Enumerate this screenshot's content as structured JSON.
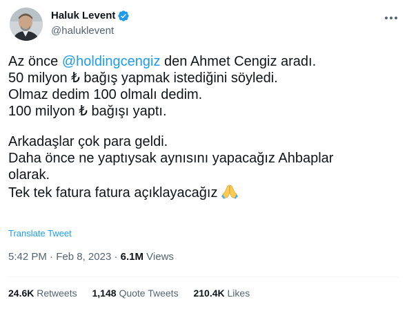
{
  "author": {
    "display_name": "Haluk Levent",
    "handle": "@haluklevent",
    "verified": true
  },
  "tweet": {
    "lines": [
      {
        "before": "Az önce ",
        "mention": "@holdingcengiz",
        "after": " den Ahmet Cengiz aradı."
      },
      {
        "text": "50 milyon ₺ bağış yapmak istediğini söyledi."
      },
      {
        "text": "Olmaz dedim 100 olmalı dedim."
      },
      {
        "text": "100 milyon ₺ bağışı yaptı."
      },
      {
        "text": "Arkadaşlar çok para geldi."
      },
      {
        "text": "Daha önce ne yaptıysak aynısını yapacağız Ahbaplar"
      },
      {
        "text": "olarak."
      },
      {
        "text": "Tek tek fatura fatura açıklayacağız"
      }
    ],
    "emoji": "folded-hands"
  },
  "translate_label": "Translate Tweet",
  "meta": {
    "time": "5:42 PM",
    "date": "Feb 8, 2023",
    "separator": "·",
    "views_count": "6.1M",
    "views_label": "Views"
  },
  "stats": {
    "retweets_count": "24.6K",
    "retweets_label": "Retweets",
    "quotes_count": "1,148",
    "quotes_label": "Quote Tweets",
    "likes_count": "210.4K",
    "likes_label": "Likes"
  },
  "colors": {
    "accent": "#1d9bf0",
    "text": "#0f1419",
    "secondary": "#536471",
    "divider": "#eff3f4"
  }
}
